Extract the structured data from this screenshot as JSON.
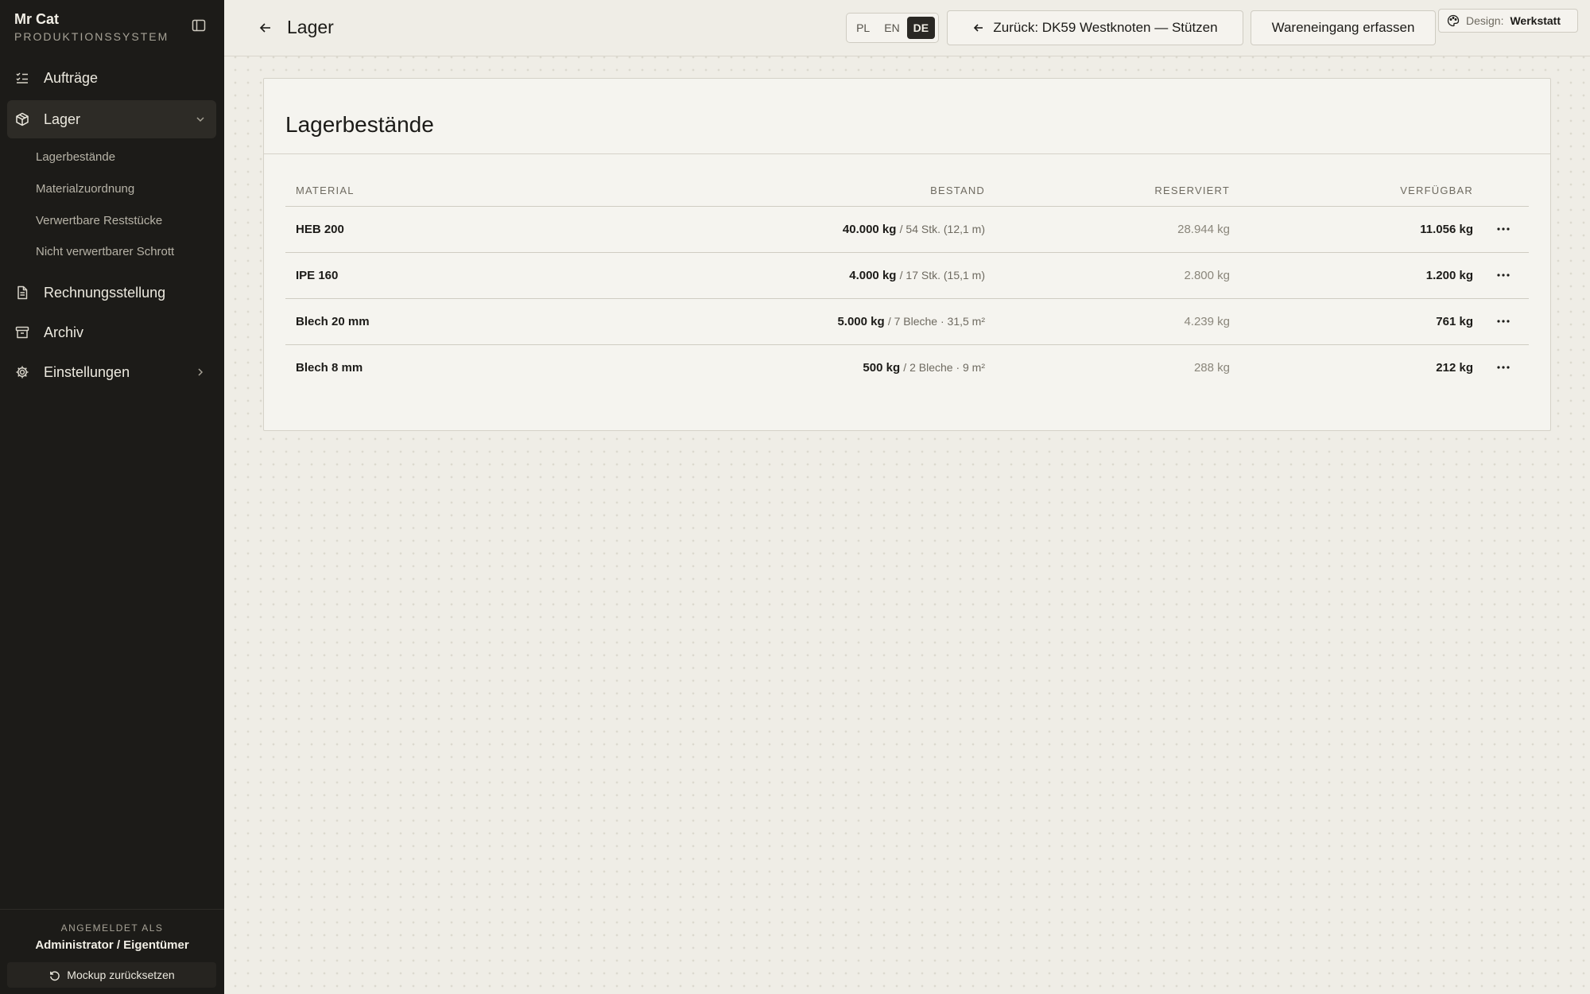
{
  "sidebar": {
    "brand": {
      "name": "Mr Cat",
      "subtitle": "PRODUKTIONSSYSTEM"
    },
    "nav": {
      "orders": "Aufträge",
      "stock": "Lager",
      "invoicing": "Rechnungsstellung",
      "archive": "Archiv",
      "settings": "Einstellungen"
    },
    "stock_sub": [
      "Lagerbestände",
      "Materialzuordnung",
      "Verwertbare Reststücke",
      "Nicht verwertbarer Schrott"
    ],
    "footer": {
      "caption": "ANGEMELDET ALS",
      "user": "Administrator / Eigentümer",
      "reset": "Mockup zurücksetzen"
    }
  },
  "topbar": {
    "title": "Lager",
    "languages": [
      "PL",
      "EN",
      "DE"
    ],
    "selected_language": "DE",
    "back_button": "Zurück: DK59 Westknoten — Stützen",
    "intake_button": "Wareneingang erfassen",
    "design": {
      "label": "Design:",
      "value": "Werkstatt"
    }
  },
  "card": {
    "title": "Lagerbestände",
    "columns": {
      "material": "MATERIAL",
      "stock": "BESTAND",
      "reserved": "RESERVIERT",
      "available": "VERFÜGBAR"
    },
    "rows": [
      {
        "material": "HEB 200",
        "stock": "40.000 kg",
        "stock_detail": "/ 54 Stk. (12,1 m)",
        "reserved": "28.944 kg",
        "available": "11.056 kg"
      },
      {
        "material": "IPE 160",
        "stock": "4.000 kg",
        "stock_detail": "/ 17 Stk. (15,1 m)",
        "reserved": "2.800 kg",
        "available": "1.200 kg"
      },
      {
        "material": "Blech 20 mm",
        "stock": "5.000 kg",
        "stock_detail": "/ 7 Bleche · 31,5 m²",
        "reserved": "4.239 kg",
        "available": "761 kg"
      },
      {
        "material": "Blech 8 mm",
        "stock": "500 kg",
        "stock_detail": "/ 2 Bleche · 9 m²",
        "reserved": "288 kg",
        "available": "212 kg"
      }
    ]
  },
  "icons": {
    "sidebar_toggle": "sidebar-toggle-icon",
    "orders": "list-check-icon",
    "stock": "package-icon",
    "invoicing": "document-icon",
    "archive": "archive-box-icon",
    "settings": "gear-icon",
    "back": "arrow-left-icon",
    "design": "palette-icon",
    "row_menu": "more-horizontal-icon",
    "reset": "rotate-ccw-icon"
  }
}
